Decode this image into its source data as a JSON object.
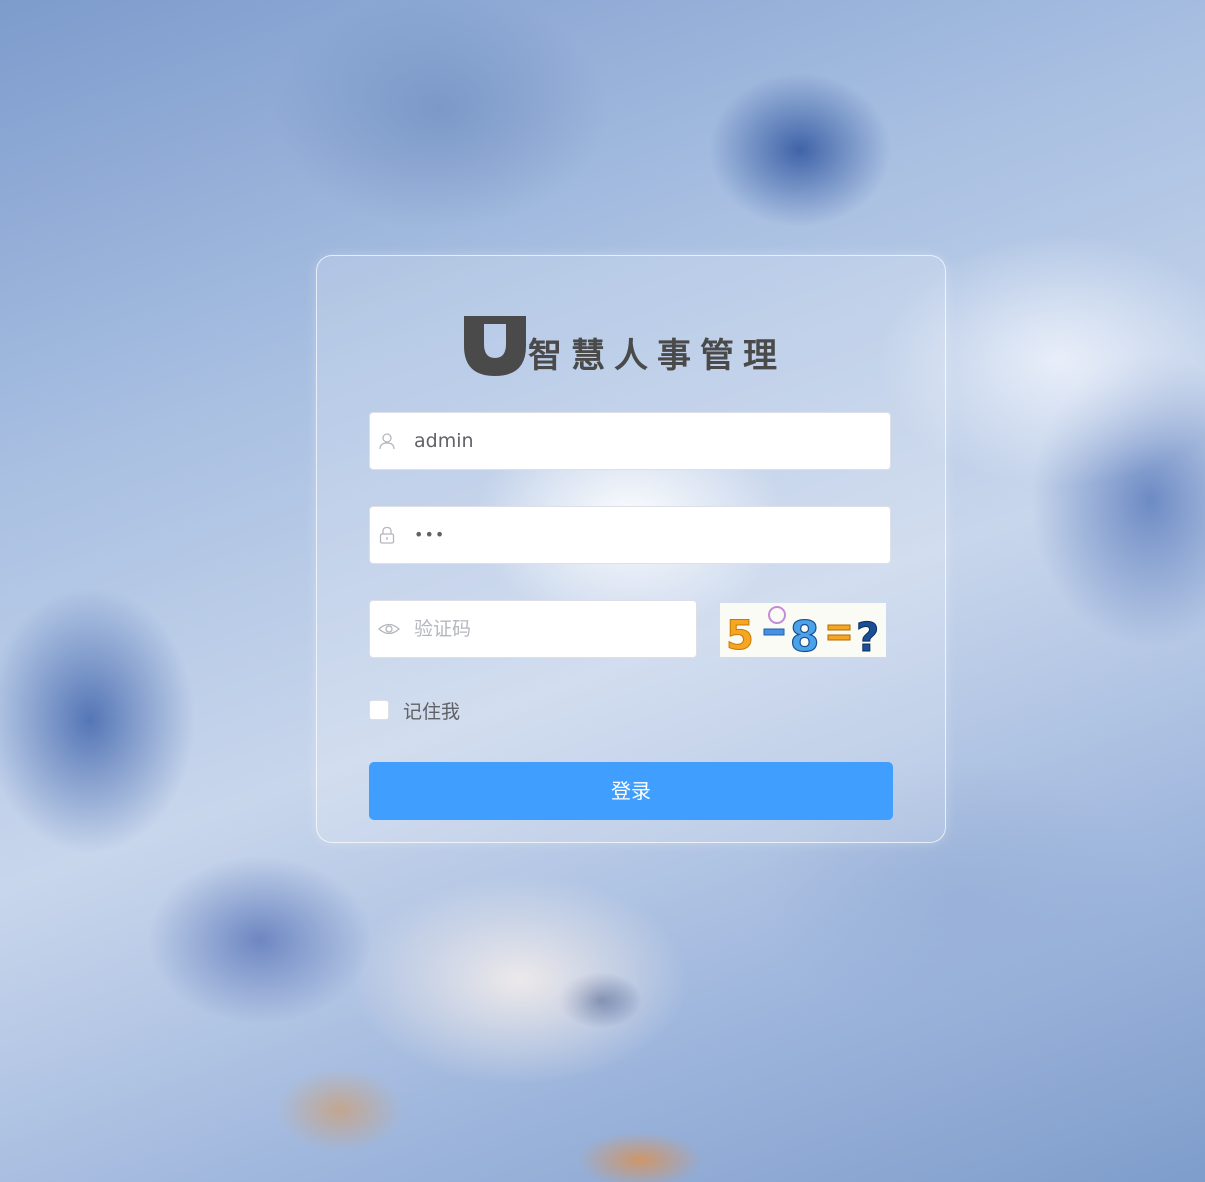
{
  "app": {
    "logo_title": "智慧人事管理",
    "logo_icon": "u-logo-icon"
  },
  "form": {
    "username": {
      "value": "admin",
      "icon": "user-icon"
    },
    "password": {
      "value": "•••",
      "icon": "lock-icon"
    },
    "captcha": {
      "placeholder": "验证码",
      "icon": "eye-icon",
      "image_text": "5−8=?"
    },
    "remember_label": "记住我",
    "login_label": "登录"
  },
  "colors": {
    "primary": "#409eff",
    "logo": "#4a4a4a",
    "input_border": "#dcdfe6"
  }
}
